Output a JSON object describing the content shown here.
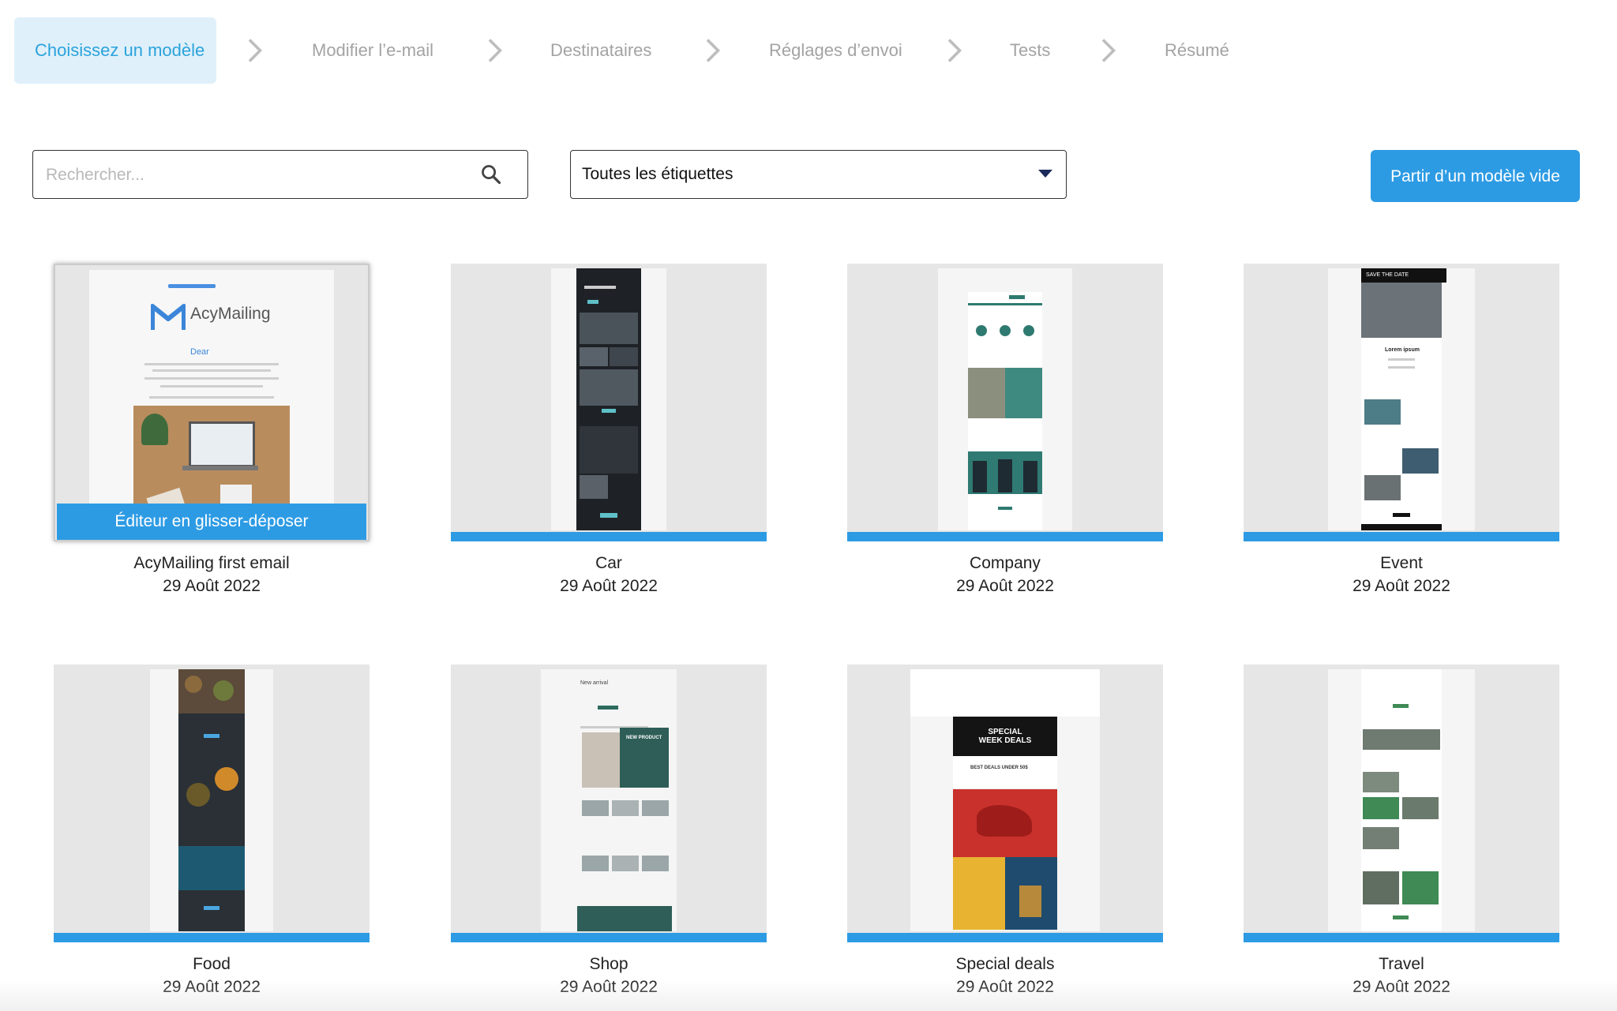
{
  "stepper": {
    "steps": [
      {
        "label": "Choisissez un modèle",
        "active": true
      },
      {
        "label": "Modifier l’e-mail",
        "active": false
      },
      {
        "label": "Destinataires",
        "active": false
      },
      {
        "label": "Réglages d’envoi",
        "active": false
      },
      {
        "label": "Tests",
        "active": false
      },
      {
        "label": "Résumé",
        "active": false
      }
    ]
  },
  "toolbar": {
    "search_placeholder": "Rechercher...",
    "search_value": "",
    "tag_filter_selected": "Toutes les étiquettes",
    "blank_button_label": "Partir d’un modèle vide"
  },
  "colors": {
    "accent": "#2d9be4",
    "active_step_bg": "#dff0fa",
    "active_step_text": "#2ba3dc",
    "inactive_step_text": "#a3a3a3"
  },
  "templates": [
    {
      "name": "AcyMailing first email",
      "date": "29 Août 2022",
      "overlay": "Éditeur en glisser-déposer",
      "preview_logo": "AcyMailing",
      "preview_greeting": "Dear"
    },
    {
      "name": "Car",
      "date": "29 Août 2022"
    },
    {
      "name": "Company",
      "date": "29 Août 2022"
    },
    {
      "name": "Event",
      "date": "29 Août 2022",
      "preview_header": "SAVE THE DATE",
      "preview_heading": "Lorem ipsum"
    },
    {
      "name": "Food",
      "date": "29 Août 2022"
    },
    {
      "name": "Shop",
      "date": "29 Août 2022",
      "preview_title": "New arrival",
      "preview_banner": "NEW PRODUCT"
    },
    {
      "name": "Special deals",
      "date": "29 Août 2022",
      "preview_banner_line1": "SPECIAL",
      "preview_banner_line2": "WEEK DEALS",
      "preview_sub": "BEST DEALS UNDER 50$"
    },
    {
      "name": "Travel",
      "date": "29 Août 2022"
    }
  ]
}
